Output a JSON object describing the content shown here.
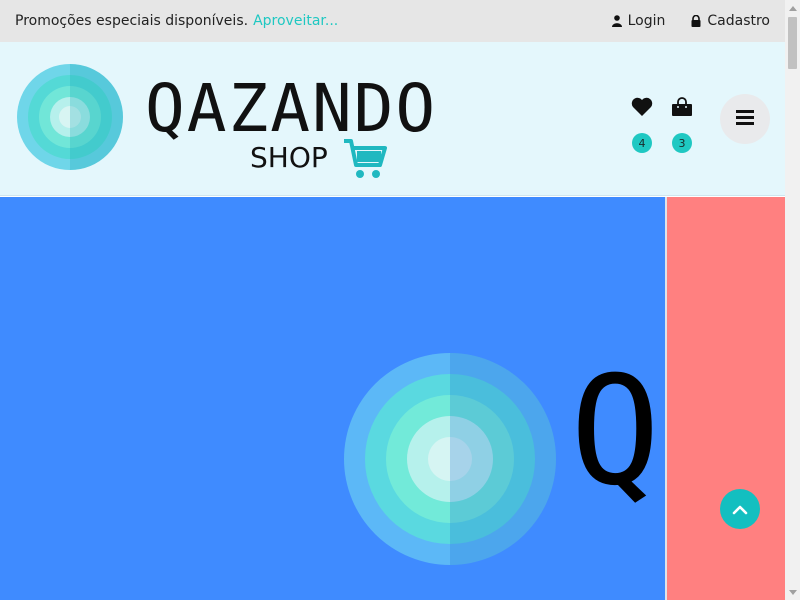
{
  "topbar": {
    "promo_text": "Promoções especiais disponíveis.",
    "promo_link": "Aproveitar...",
    "login_label": "Login",
    "signup_label": "Cadastro"
  },
  "header": {
    "brand_name": "QAZANDO",
    "brand_sub": "SHOP",
    "wishlist_count": "4",
    "cart_count": "3"
  },
  "banner": {
    "brand_text": "Qa"
  },
  "colors": {
    "accent": "#1fc8c2",
    "banner_bg": "#3f8bff",
    "banner_side_bg": "#ff8080",
    "header_bg": "#e4f7fc",
    "topbar_bg": "#e6e6e6"
  },
  "icons": {
    "login": "user-icon",
    "signup": "lock-icon",
    "wishlist": "heart-icon",
    "cart": "shopping-bag-icon",
    "menu": "hamburger-menu-icon",
    "back_to_top": "chevron-up-icon"
  }
}
